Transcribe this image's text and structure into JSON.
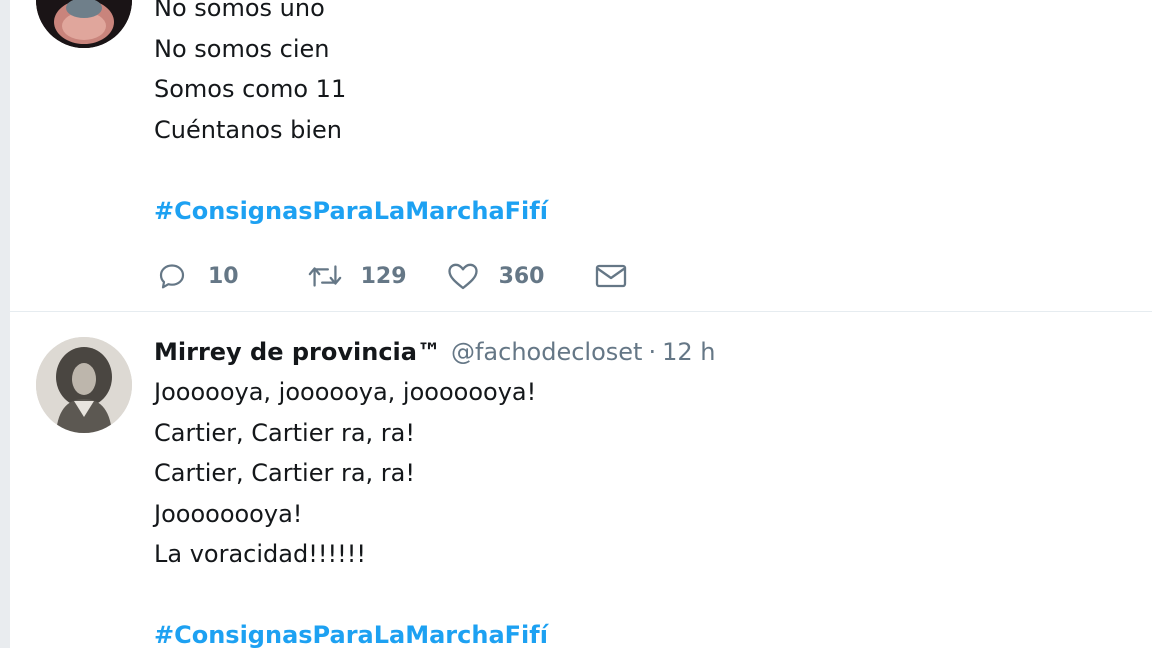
{
  "tweets": [
    {
      "body_lines": [
        "No somos uno",
        "No somos cien",
        "Somos como 11",
        "Cuéntanos bien"
      ],
      "hashtag": "#ConsignasParaLaMarchaFifí",
      "actions": {
        "reply_count": "10",
        "retweet_count": "129",
        "like_count": "360"
      }
    },
    {
      "display_name": "Mirrey de provincia™",
      "handle": "@fachodecloset",
      "separator": "·",
      "time": "12 h",
      "body_lines": [
        "Joooooya, joooooya, jooooooya!",
        "Cartier, Cartier ra, ra!",
        "Cartier, Cartier ra, ra!",
        "Joooooooya!",
        "La voracidad!!!!!!"
      ],
      "hashtag": "#ConsignasParaLaMarchaFifí"
    }
  ],
  "icons": {
    "reply": "reply-icon",
    "retweet": "retweet-icon",
    "like": "heart-icon",
    "dm": "envelope-icon"
  },
  "colors": {
    "link": "#1da1f2",
    "muted": "#657786",
    "text": "#14171a",
    "divider": "#e6ecf0"
  }
}
